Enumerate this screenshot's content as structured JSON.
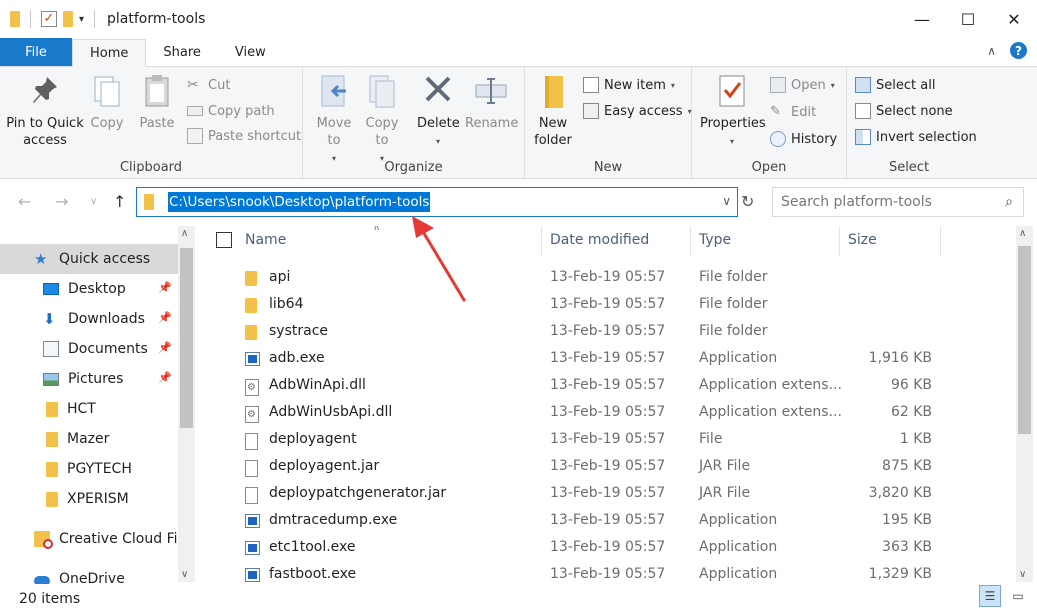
{
  "window": {
    "title": "platform-tools"
  },
  "ribbon_tabs": [
    "File",
    "Home",
    "Share",
    "View"
  ],
  "ribbon": {
    "clipboard": {
      "label": "Clipboard",
      "pin": "Pin to Quick access",
      "copy": "Copy",
      "paste": "Paste",
      "cut": "Cut",
      "copy_path": "Copy path",
      "paste_shortcut": "Paste shortcut"
    },
    "organize": {
      "label": "Organize",
      "move_to": "Move to",
      "copy_to": "Copy to",
      "delete": "Delete",
      "rename": "Rename"
    },
    "new": {
      "label": "New",
      "new_folder": "New folder",
      "new_item": "New item",
      "easy_access": "Easy access"
    },
    "open": {
      "label": "Open",
      "properties": "Properties",
      "open": "Open",
      "edit": "Edit",
      "history": "History"
    },
    "select": {
      "label": "Select",
      "select_all": "Select all",
      "select_none": "Select none",
      "invert": "Invert selection"
    }
  },
  "address": {
    "path": "C:\\Users\\snook\\Desktop\\platform-tools"
  },
  "search": {
    "placeholder": "Search platform-tools"
  },
  "nav": {
    "quick_access": "Quick access",
    "items": [
      {
        "label": "Desktop",
        "pinned": true
      },
      {
        "label": "Downloads",
        "pinned": true
      },
      {
        "label": "Documents",
        "pinned": true
      },
      {
        "label": "Pictures",
        "pinned": true
      },
      {
        "label": "HCT"
      },
      {
        "label": "Mazer"
      },
      {
        "label": "PGYTECH"
      },
      {
        "label": "XPERISM"
      }
    ],
    "creative_cloud": "Creative Cloud Files",
    "onedrive": "OneDrive"
  },
  "columns": {
    "name": "Name",
    "date": "Date modified",
    "type": "Type",
    "size": "Size"
  },
  "files": [
    {
      "name": "api",
      "date": "13-Feb-19 05:57",
      "type": "File folder",
      "size": "",
      "icon": "folder"
    },
    {
      "name": "lib64",
      "date": "13-Feb-19 05:57",
      "type": "File folder",
      "size": "",
      "icon": "folder"
    },
    {
      "name": "systrace",
      "date": "13-Feb-19 05:57",
      "type": "File folder",
      "size": "",
      "icon": "folder"
    },
    {
      "name": "adb.exe",
      "date": "13-Feb-19 05:57",
      "type": "Application",
      "size": "1,916 KB",
      "icon": "exe"
    },
    {
      "name": "AdbWinApi.dll",
      "date": "13-Feb-19 05:57",
      "type": "Application extens...",
      "size": "96 KB",
      "icon": "dll"
    },
    {
      "name": "AdbWinUsbApi.dll",
      "date": "13-Feb-19 05:57",
      "type": "Application extens...",
      "size": "62 KB",
      "icon": "dll"
    },
    {
      "name": "deployagent",
      "date": "13-Feb-19 05:57",
      "type": "File",
      "size": "1 KB",
      "icon": "file"
    },
    {
      "name": "deployagent.jar",
      "date": "13-Feb-19 05:57",
      "type": "JAR File",
      "size": "875 KB",
      "icon": "file"
    },
    {
      "name": "deploypatchgenerator.jar",
      "date": "13-Feb-19 05:57",
      "type": "JAR File",
      "size": "3,820 KB",
      "icon": "file"
    },
    {
      "name": "dmtracedump.exe",
      "date": "13-Feb-19 05:57",
      "type": "Application",
      "size": "195 KB",
      "icon": "exe"
    },
    {
      "name": "etc1tool.exe",
      "date": "13-Feb-19 05:57",
      "type": "Application",
      "size": "363 KB",
      "icon": "exe"
    },
    {
      "name": "fastboot.exe",
      "date": "13-Feb-19 05:57",
      "type": "Application",
      "size": "1,329 KB",
      "icon": "exe"
    }
  ],
  "status": {
    "count": "20 items"
  },
  "colors": {
    "accent": "#1979ca",
    "selection": "#0078d7",
    "annotation": "#e53935"
  }
}
